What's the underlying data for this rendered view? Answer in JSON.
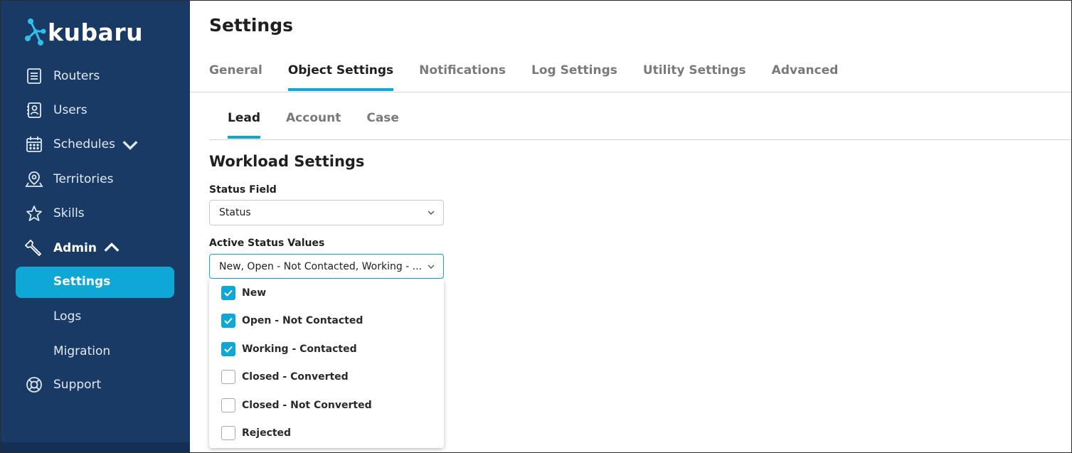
{
  "app": {
    "name": "kubaru"
  },
  "sidebar": {
    "items": [
      {
        "label": "Routers",
        "icon": "list-icon"
      },
      {
        "label": "Users",
        "icon": "contacts-icon"
      },
      {
        "label": "Schedules",
        "icon": "calendar-icon"
      },
      {
        "label": "Territories",
        "icon": "map-pin-icon"
      },
      {
        "label": "Skills",
        "icon": "star-icon"
      },
      {
        "label": "Admin",
        "icon": "wrench-icon"
      },
      {
        "label": "Support",
        "icon": "lifebuoy-icon"
      }
    ],
    "admin_sub": [
      "Settings",
      "Logs",
      "Migration"
    ],
    "active": "Settings"
  },
  "page": {
    "title": "Settings",
    "tabs": [
      "General",
      "Object Settings",
      "Notifications",
      "Log Settings",
      "Utility Settings",
      "Advanced"
    ],
    "active_tab": "Object Settings",
    "subtabs": [
      "Lead",
      "Account",
      "Case"
    ],
    "active_subtab": "Lead"
  },
  "workload": {
    "title": "Workload Settings",
    "status_field_label": "Status Field",
    "status_field_value": "Status",
    "active_values_label": "Active Status Values",
    "active_values_value": "New, Open - Not Contacted, Working - ...",
    "options": [
      {
        "label": "New",
        "checked": true
      },
      {
        "label": "Open - Not Contacted",
        "checked": true
      },
      {
        "label": "Working - Contacted",
        "checked": true
      },
      {
        "label": "Closed - Converted",
        "checked": false
      },
      {
        "label": "Closed - Not Converted",
        "checked": false
      },
      {
        "label": "Rejected",
        "checked": false
      }
    ]
  },
  "colors": {
    "sidebar": "#1a3a66",
    "accent": "#0fa7d6"
  }
}
